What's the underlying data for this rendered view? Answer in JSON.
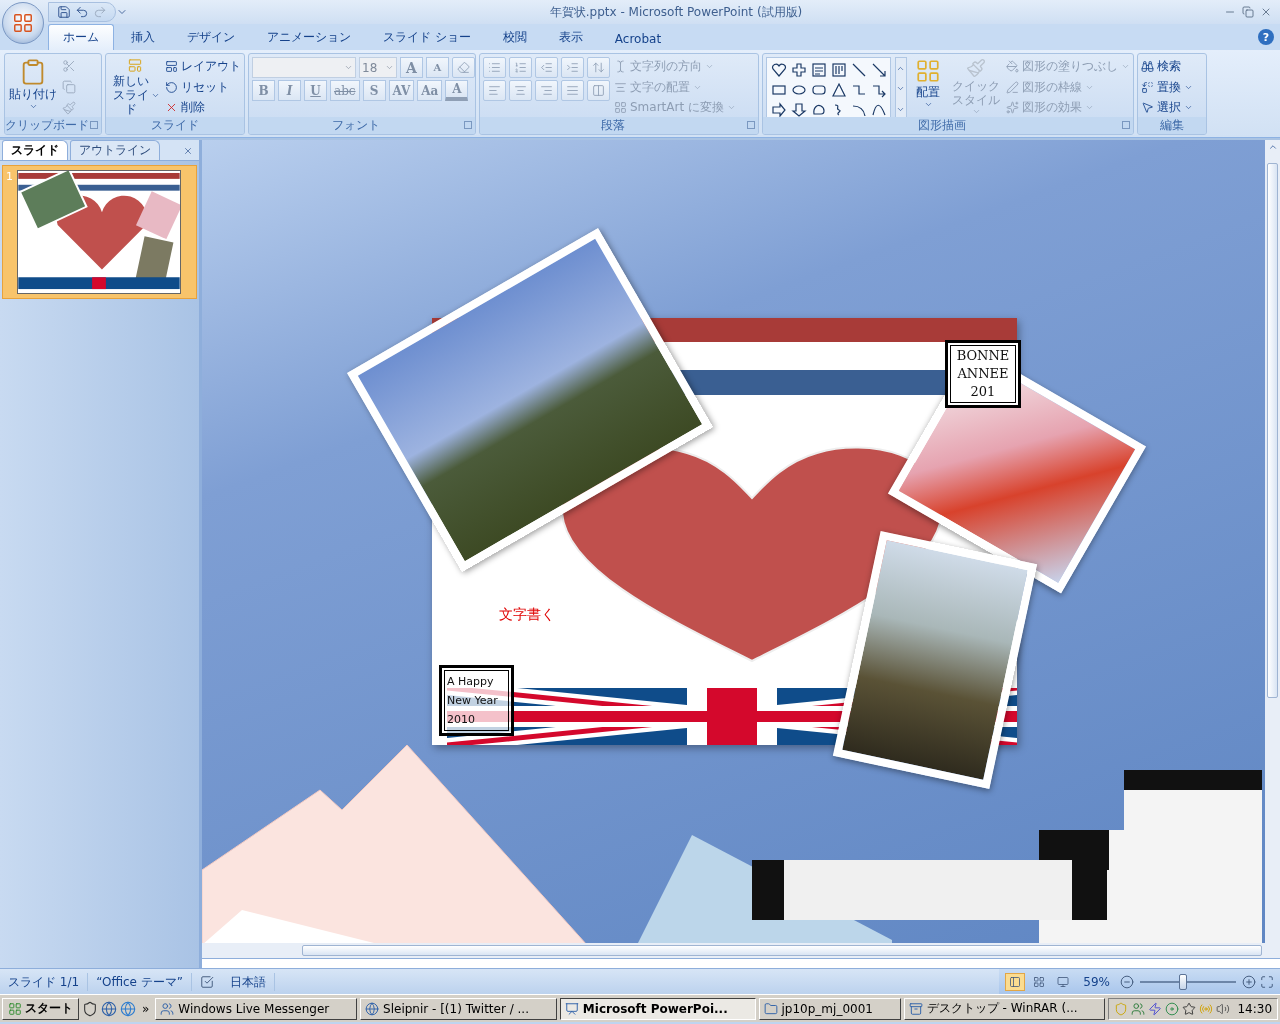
{
  "window": {
    "title": "年賀状.pptx - Microsoft PowerPoint (試用版)"
  },
  "help": "?",
  "tabs": [
    {
      "label": "ホーム",
      "selected": true
    },
    {
      "label": "挿入",
      "selected": false
    },
    {
      "label": "デザイン",
      "selected": false
    },
    {
      "label": "アニメーション",
      "selected": false
    },
    {
      "label": "スライド ショー",
      "selected": false
    },
    {
      "label": "校閲",
      "selected": false
    },
    {
      "label": "表示",
      "selected": false
    },
    {
      "label": "Acrobat",
      "selected": false
    }
  ],
  "ribbon": [
    {
      "kind": "clipboard",
      "label": "クリップボード",
      "paste": {
        "label": "貼り付け",
        "disabled": false
      }
    },
    {
      "kind": "slides",
      "label": "スライド",
      "new_slide": {
        "label": "新しいスライド"
      },
      "items": [
        {
          "label": "レイアウト",
          "disabled": false
        },
        {
          "label": "リセット",
          "disabled": false
        },
        {
          "label": "削除",
          "disabled": false
        }
      ]
    },
    {
      "kind": "font",
      "label": "フォント",
      "size": {
        "value": "18",
        "disabled": true
      },
      "grow": [
        {
          "label": "A",
          "disabled": true
        },
        {
          "label": "A",
          "disabled": true
        }
      ],
      "buttons": [
        {
          "kind": "bold",
          "label": "B",
          "disabled": true
        },
        {
          "kind": "italic",
          "label": "I",
          "disabled": true
        },
        {
          "kind": "underline",
          "label": "U",
          "disabled": true
        },
        {
          "kind": "strike",
          "label": "abc",
          "disabled": true
        },
        {
          "kind": "shadow",
          "label": "S",
          "disabled": true
        },
        {
          "kind": "spacing",
          "label": "AV",
          "disabled": true
        },
        {
          "kind": "case",
          "label": "Aa",
          "disabled": true
        },
        {
          "kind": "color",
          "label": "A",
          "disabled": true
        }
      ]
    },
    {
      "kind": "paragraph",
      "label": "段落",
      "items": [
        {
          "label": "文字列の方向",
          "disabled": true
        },
        {
          "label": "文字の配置",
          "disabled": true
        },
        {
          "label": "SmartArt に変換",
          "disabled": true
        }
      ]
    },
    {
      "kind": "drawing",
      "label": "図形描画",
      "arrange": {
        "label": "配置",
        "disabled": false
      },
      "quick": {
        "label": "クイックスタイル",
        "disabled": true
      },
      "items": [
        {
          "label": "図形の塗りつぶし",
          "disabled": true
        },
        {
          "label": "図形の枠線",
          "disabled": true
        },
        {
          "label": "図形の効果",
          "disabled": true
        }
      ]
    },
    {
      "kind": "editing",
      "label": "編集",
      "items": [
        {
          "kind": "find",
          "label": "検索",
          "disabled": false
        },
        {
          "kind": "replace",
          "label": "置換",
          "disabled": false
        },
        {
          "kind": "select",
          "label": "選択",
          "disabled": false
        }
      ]
    }
  ],
  "panel": {
    "tabs": [
      {
        "label": "スライド",
        "selected": true
      },
      {
        "label": "アウトライン",
        "selected": false
      }
    ],
    "thumbnails": [
      {
        "number": "1",
        "selected": true
      }
    ]
  },
  "slide": {
    "corner_title": [
      "BONNE",
      "ANNEE",
      "201"
    ],
    "note": "文字書く",
    "greeting": [
      "A Happy",
      "New Year",
      "2010"
    ]
  },
  "status_bar": {
    "left": [
      "スライド 1/1",
      "“Office テーマ”"
    ],
    "language": "日本語",
    "views": [
      {
        "selected": true
      },
      {
        "selected": false
      },
      {
        "selected": false
      }
    ],
    "zoom": "59%",
    "zoom_level": {
      "level": 0.45
    }
  },
  "taskbar": {
    "start": "スタート",
    "more": "»",
    "tasks": [
      {
        "kind": "messenger",
        "label": "Windows Live Messenger",
        "selected": false
      },
      {
        "kind": "browser",
        "label": "Sleipnir - [(1) Twitter / ...",
        "selected": false
      },
      {
        "kind": "powerpoint",
        "label": "Microsoft PowerPoi...",
        "selected": true
      },
      {
        "kind": "folder",
        "label": "jp10p_mj_0001",
        "selected": false
      },
      {
        "kind": "archive",
        "label": "デスクトップ - WinRAR (...",
        "selected": false
      }
    ],
    "clock": "14:30"
  }
}
